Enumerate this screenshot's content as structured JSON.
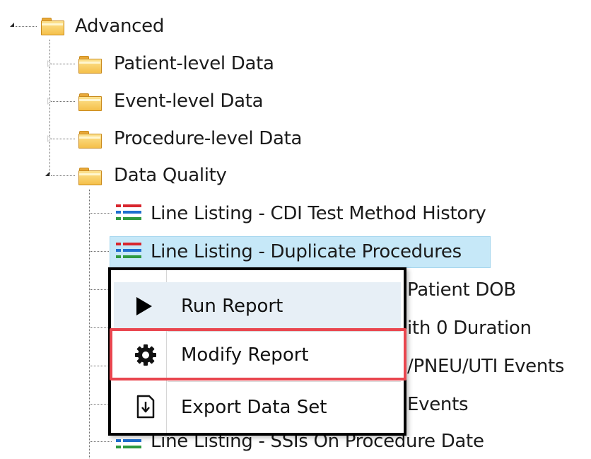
{
  "tree": {
    "root": {
      "label": "Advanced"
    },
    "folders": [
      {
        "label": "Patient-level Data"
      },
      {
        "label": "Event-level Data"
      },
      {
        "label": "Procedure-level Data"
      },
      {
        "label": "Data Quality"
      }
    ],
    "reports": [
      {
        "label": "Line Listing - CDI Test Method History"
      },
      {
        "label": "Line Listing - Duplicate Procedures"
      },
      {
        "label": "Patient DOB"
      },
      {
        "label": "ith 0 Duration"
      },
      {
        "label": "/PNEU/UTI Events"
      },
      {
        "label": "Events"
      },
      {
        "label": "Line Listing - SSIs On Procedure Date"
      }
    ]
  },
  "context_menu": {
    "items": [
      {
        "label": "Run Report",
        "icon": "play-icon"
      },
      {
        "label": "Modify Report",
        "icon": "gear-icon"
      },
      {
        "label": "Export Data Set",
        "icon": "export-icon"
      }
    ]
  },
  "colors": {
    "selection": "#c6e8f8",
    "highlight": "#e9464f",
    "icon_red": "#d8262e",
    "icon_blue": "#1f6fcf",
    "icon_green": "#2f9a3f"
  }
}
